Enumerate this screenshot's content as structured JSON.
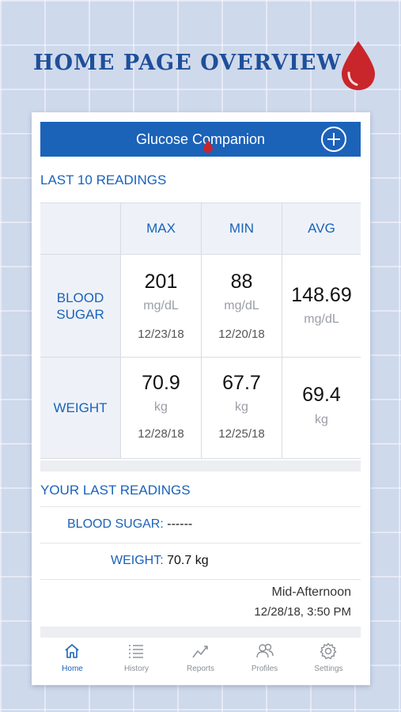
{
  "headline": "HOME PAGE OVERVIEW",
  "header": {
    "title": "Glucose Companion",
    "add_icon": "plus-circle-icon"
  },
  "last10": {
    "heading": "LAST 10 READINGS",
    "columns": [
      "MAX",
      "MIN",
      "AVG"
    ],
    "rows": [
      {
        "label": "BLOOD SUGAR",
        "max": {
          "value": "201",
          "unit": "mg/dL",
          "date": "12/23/18"
        },
        "min": {
          "value": "88",
          "unit": "mg/dL",
          "date": "12/20/18"
        },
        "avg": {
          "value": "148.69",
          "unit": "mg/dL"
        }
      },
      {
        "label": "WEIGHT",
        "max": {
          "value": "70.9",
          "unit": "kg",
          "date": "12/28/18"
        },
        "min": {
          "value": "67.7",
          "unit": "kg",
          "date": "12/25/18"
        },
        "avg": {
          "value": "69.4",
          "unit": "kg"
        }
      }
    ]
  },
  "last_readings": {
    "heading": "YOUR LAST READINGS",
    "blood_sugar_label": "BLOOD SUGAR:",
    "blood_sugar_value": "------",
    "weight_label": "WEIGHT:",
    "weight_value": "70.7 kg",
    "time_of_day": "Mid-Afternoon",
    "timestamp": "12/28/18, 3:50 PM"
  },
  "tabs": [
    {
      "label": "Home",
      "icon": "home-icon",
      "active": true
    },
    {
      "label": "History",
      "icon": "list-icon",
      "active": false
    },
    {
      "label": "Reports",
      "icon": "trend-chart-icon",
      "active": false
    },
    {
      "label": "Profiles",
      "icon": "users-icon",
      "active": false
    },
    {
      "label": "Settings",
      "icon": "gear-icon",
      "active": false
    }
  ],
  "colors": {
    "brand_blue": "#1b62b9",
    "headline_blue": "#1f4f9a",
    "drop_red": "#c8262b"
  }
}
